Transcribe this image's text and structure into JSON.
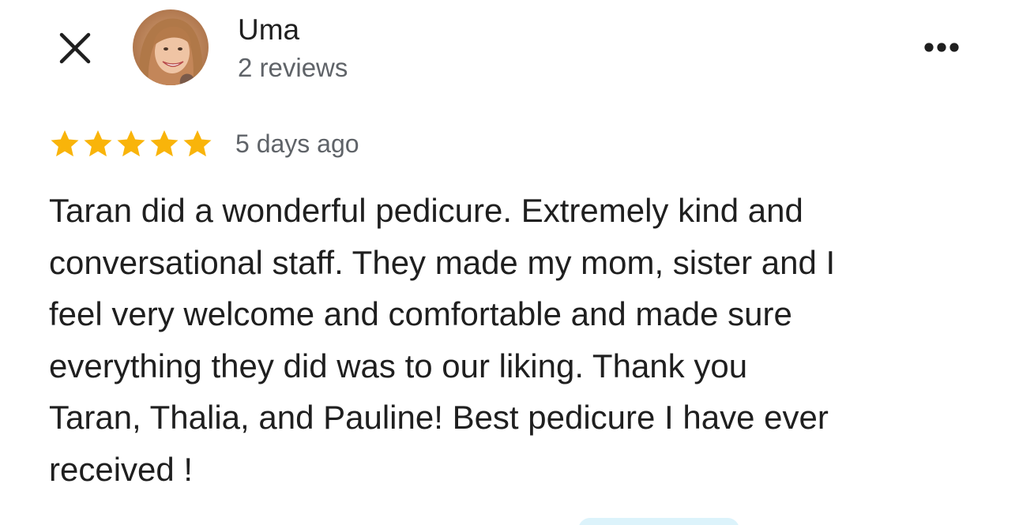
{
  "reviewer": {
    "name": "Uma",
    "review_count": "2 reviews"
  },
  "review": {
    "rating": 5,
    "max_rating": 5,
    "time_ago": "5 days ago",
    "lines": [
      "Taran did a wonderful pedicure. Extremely kind and",
      "conversational staff. They made my mom, sister and I",
      "feel very welcome and comfortable and made sure",
      "everything they did was to our liking. Thank you",
      "Taran, Thalia, and Pauline! Best pedicure I have ever",
      "received !"
    ]
  },
  "icons": {
    "close": "close-icon",
    "more": "more-horizontal-icon",
    "star": "star-icon"
  },
  "colors": {
    "star": "#f9b40a",
    "text": "#1f1f1f",
    "secondary_text": "#5f6368",
    "pill": "#dcf3fb"
  }
}
